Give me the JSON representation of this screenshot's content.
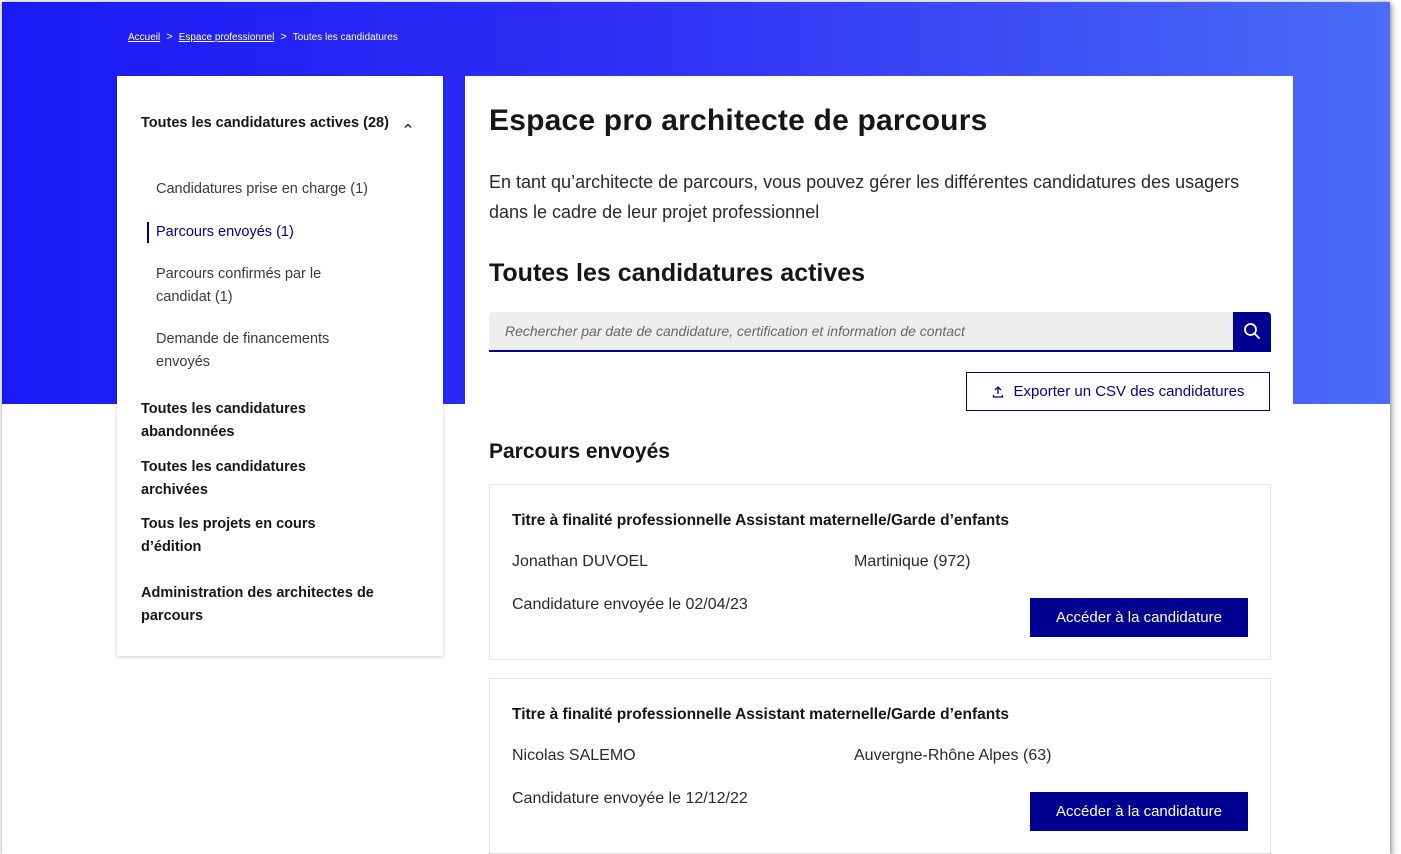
{
  "breadcrumb": {
    "home": "Accueil",
    "pro_space": "Espace professionnel",
    "current": "Toutes les candidatures",
    "separator": ">"
  },
  "sidebar": {
    "active_group": {
      "title": "Toutes les candidatures actives (28)",
      "expanded": true,
      "items": [
        {
          "label": "Candidatures prise en charge (1)",
          "active": false
        },
        {
          "label": "Parcours envoyés (1)",
          "active": true
        },
        {
          "label": "Parcours confirmés par le candidat (1)",
          "active": false
        },
        {
          "label": "Demande de financements envoyés",
          "active": false
        }
      ]
    },
    "links": [
      {
        "label": "Toutes les candidatures abandonnées"
      },
      {
        "label": "Toutes les candidatures archivées"
      },
      {
        "label": "Tous les projets en cours d’édition"
      },
      {
        "label": "Administration des architectes de parcours"
      }
    ]
  },
  "main": {
    "title": "Espace pro architecte de parcours",
    "intro": "En tant qu’architecte de parcours, vous pouvez gérer les différentes candidatures des usagers dans le cadre de leur projet professionnel",
    "section_title": "Toutes les candidatures actives",
    "search": {
      "placeholder": "Rechercher par date de candidature, certification et information de contact",
      "value": ""
    },
    "export_label": "Exporter un CSV des candidatures",
    "subsection_title": "Parcours envoyés",
    "cards": [
      {
        "title": "Titre à finalité professionnelle Assistant maternelle/Garde d’enfants",
        "name": "Jonathan DUVOEL",
        "region": "Martinique (972)",
        "date": "Candidature envoyée le 02/04/23",
        "button": "Accéder à la candidature"
      },
      {
        "title": "Titre à finalité professionnelle Assistant maternelle/Garde d’enfants",
        "name": "Nicolas SALEMO",
        "region": "Auvergne-Rhône Alpes (63)",
        "date": "Candidature envoyée le 12/12/22",
        "button": "Accéder à la candidature"
      }
    ]
  },
  "icons": {
    "search": "search-icon",
    "export": "upload-icon",
    "collapse": "chevron-up-icon"
  },
  "colors": {
    "primary": "#000091",
    "hero_start": "#1a1af5",
    "hero_end": "#4a6cf7",
    "search_bg": "#eeeeee"
  }
}
